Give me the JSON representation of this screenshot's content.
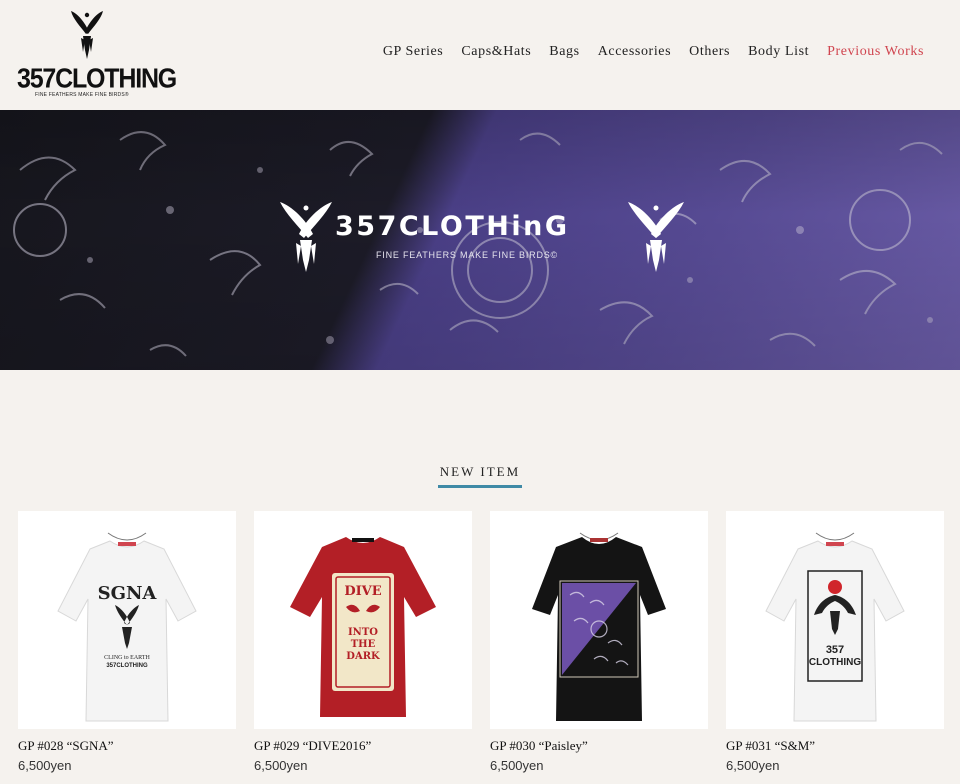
{
  "brand": {
    "name": "357CLOTHING",
    "tagline": "FINE FEATHERS MAKE FINE BIRDS®"
  },
  "nav": {
    "items": [
      {
        "label": "GP Series",
        "active": false
      },
      {
        "label": "Caps&Hats",
        "active": false
      },
      {
        "label": "Bags",
        "active": false
      },
      {
        "label": "Accessories",
        "active": false
      },
      {
        "label": "Others",
        "active": false
      },
      {
        "label": "Body List",
        "active": false
      },
      {
        "label": "Previous Works",
        "active": true
      }
    ]
  },
  "hero": {
    "title": "357CLOTHinG",
    "tagline": "FINE FEATHERS MAKE FINE BIRDS©"
  },
  "section": {
    "title": "NEW ITEM"
  },
  "products": [
    {
      "name": "GP #028 “SGNA”",
      "price": "6,500yen",
      "shirt_color": "#f4f4f4",
      "print_text": [
        "SGNA",
        "CLING to EARTH",
        "357CLOTHING"
      ]
    },
    {
      "name": "GP #029 “DIVE2016”",
      "price": "6,500yen",
      "shirt_color": "#b31f26",
      "print_text": [
        "DIVE",
        "INTO",
        "THE",
        "DARK"
      ]
    },
    {
      "name": "GP #030 “Paisley”",
      "price": "6,500yen",
      "shirt_color": "#141414",
      "print_text": []
    },
    {
      "name": "GP #031 “S&M”",
      "price": "6,500yen",
      "shirt_color": "#f4f4f4",
      "print_text": [
        "357",
        "CLOTHING"
      ]
    }
  ],
  "colors": {
    "background": "#f5f2ee",
    "accent_active": "#d0454f",
    "section_underline": "#3f8aa6"
  }
}
